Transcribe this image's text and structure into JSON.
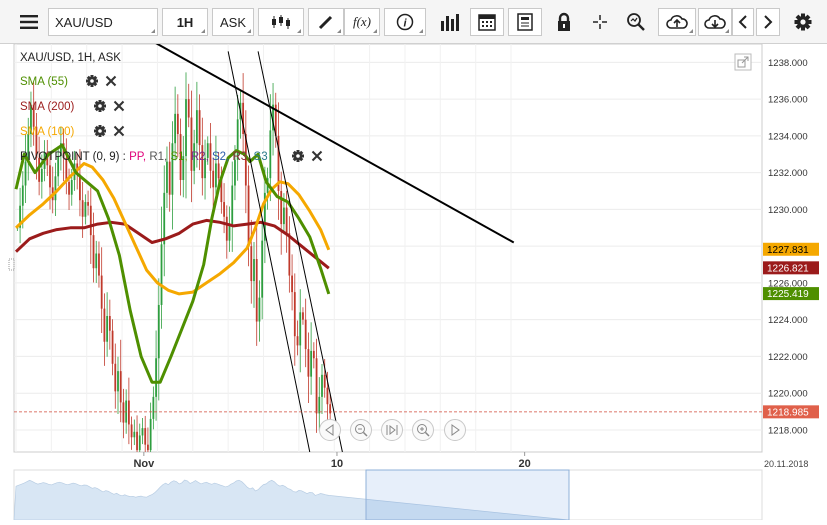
{
  "toolbar": {
    "symbol": "XAU/USD",
    "timeframe": "1H",
    "price_type": "ASK",
    "icons": [
      "menu-icon",
      "candles-icon",
      "pencil-icon",
      "function-icon",
      "info-icon",
      "volume-bars-icon",
      "calendar-icon",
      "news-icon",
      "lock-icon",
      "crosshair-icon",
      "zoom-icon",
      "upload-icon",
      "download-icon",
      "chevron-left-icon",
      "chevron-right-icon",
      "gear-icon"
    ],
    "function_label": "f(x)",
    "info_label": "i"
  },
  "chart_data": {
    "type": "candlestick",
    "title": "XAU/USD, 1H, ASK",
    "y_range": [
      1216.8,
      1239.0
    ],
    "y_ticks": [
      1218.0,
      1220.0,
      1222.0,
      1224.0,
      1226.0,
      1228.0,
      1230.0,
      1232.0,
      1234.0,
      1236.0,
      1238.0
    ],
    "x_ticks": [
      {
        "label": "Nov",
        "bar": 47
      },
      {
        "label": "10",
        "bar": 118
      },
      {
        "label": "20",
        "bar": 187
      }
    ],
    "x_end_label": "20.11.2018",
    "bar_count": 191,
    "indicators": [
      {
        "name": "SMA (55)",
        "color": "#4e8f00"
      },
      {
        "name": "SMA (200)",
        "color": "#9b1b1b"
      },
      {
        "name": "SMA (100)",
        "color": "#f5a800"
      }
    ],
    "pivot": {
      "label": "PIVOTPOINT (0, 9)",
      "colon": ":",
      "levels": [
        {
          "name": "PP",
          "color": "#e0007a"
        },
        {
          "name": "R1",
          "color": "#555555"
        },
        {
          "name": "S1",
          "color": "#4e8f00"
        },
        {
          "name": "R2",
          "color": "#7a2a8a"
        },
        {
          "name": "S2",
          "color": "#2a5caa"
        },
        {
          "name": "R3",
          "color": "#8a2a3a"
        },
        {
          "name": "S3",
          "color": "#2a7a8a"
        }
      ]
    },
    "price_labels": [
      {
        "value": 1227.831,
        "text": "1227.831",
        "color": "#f5a800",
        "text_color": "#000000"
      },
      {
        "value": 1226.821,
        "text": "1226.821",
        "color": "#9b1b1b",
        "text_color": "#ffffff"
      },
      {
        "value": 1225.419,
        "text": "1225.419",
        "color": "#4e8f00",
        "text_color": "#ffffff"
      },
      {
        "value": 1218.985,
        "text": "1218.985",
        "color": "#e0604a",
        "text_color": "#ffffff"
      }
    ],
    "current_price": 1218.985,
    "trend_lines": [
      {
        "color": "#000000",
        "width": 2,
        "points": [
          [
            -5,
            1243.7
          ],
          [
            183,
            1228.2
          ]
        ]
      },
      {
        "color": "#000000",
        "width": 1,
        "points": [
          [
            78,
            1238.6
          ],
          [
            108,
            1216.8
          ]
        ]
      },
      {
        "color": "#000000",
        "width": 1,
        "points": [
          [
            89,
            1238.6
          ],
          [
            120,
            1216.8
          ]
        ]
      }
    ],
    "sma55_points": [
      [
        0,
        1231.1
      ],
      [
        3,
        1233.0
      ],
      [
        7,
        1232.0
      ],
      [
        12,
        1233.0
      ],
      [
        17,
        1233.5
      ],
      [
        22,
        1232.0
      ],
      [
        26,
        1231.5
      ],
      [
        30,
        1231.0
      ],
      [
        34,
        1229.5
      ],
      [
        38,
        1227.5
      ],
      [
        42,
        1224.5
      ],
      [
        46,
        1222.0
      ],
      [
        50,
        1220.6
      ],
      [
        53,
        1220.6
      ],
      [
        57,
        1222.0
      ],
      [
        61,
        1223.5
      ],
      [
        65,
        1225.0
      ],
      [
        69,
        1227.0
      ],
      [
        72,
        1229.5
      ],
      [
        75,
        1231.5
      ],
      [
        78,
        1232.8
      ],
      [
        81,
        1233.2
      ],
      [
        84,
        1233.0
      ],
      [
        86,
        1232.6
      ],
      [
        89,
        1233.0
      ],
      [
        92,
        1231.5
      ],
      [
        96,
        1230.7
      ],
      [
        100,
        1230.4
      ],
      [
        104,
        1229.5
      ],
      [
        108,
        1228.5
      ],
      [
        112,
        1226.8
      ],
      [
        115,
        1225.4
      ]
    ],
    "sma200_points": [
      [
        0,
        1227.7
      ],
      [
        5,
        1228.4
      ],
      [
        10,
        1228.7
      ],
      [
        15,
        1228.9
      ],
      [
        20,
        1229.0
      ],
      [
        25,
        1229.0
      ],
      [
        30,
        1229.2
      ],
      [
        35,
        1229.3
      ],
      [
        40,
        1229.2
      ],
      [
        45,
        1228.7
      ],
      [
        50,
        1228.2
      ],
      [
        55,
        1228.4
      ],
      [
        60,
        1228.7
      ],
      [
        65,
        1229.2
      ],
      [
        70,
        1229.4
      ],
      [
        75,
        1229.3
      ],
      [
        80,
        1229.1
      ],
      [
        85,
        1229.2
      ],
      [
        90,
        1229.3
      ],
      [
        95,
        1229.1
      ],
      [
        100,
        1228.6
      ],
      [
        105,
        1228.0
      ],
      [
        110,
        1227.4
      ],
      [
        115,
        1226.8
      ]
    ],
    "sma100_points": [
      [
        0,
        1229.0
      ],
      [
        5,
        1229.7
      ],
      [
        10,
        1230.3
      ],
      [
        15,
        1231.0
      ],
      [
        20,
        1231.8
      ],
      [
        25,
        1232.5
      ],
      [
        28,
        1232.3
      ],
      [
        32,
        1231.6
      ],
      [
        36,
        1230.6
      ],
      [
        40,
        1229.3
      ],
      [
        44,
        1228.0
      ],
      [
        48,
        1226.7
      ],
      [
        52,
        1226.0
      ],
      [
        56,
        1225.6
      ],
      [
        60,
        1225.4
      ],
      [
        65,
        1225.5
      ],
      [
        70,
        1226.0
      ],
      [
        75,
        1226.5
      ],
      [
        80,
        1227.1
      ],
      [
        85,
        1227.9
      ],
      [
        88,
        1229.0
      ],
      [
        91,
        1230.3
      ],
      [
        94,
        1231.1
      ],
      [
        97,
        1231.5
      ],
      [
        100,
        1231.4
      ],
      [
        104,
        1230.8
      ],
      [
        108,
        1229.9
      ],
      [
        112,
        1228.9
      ],
      [
        115,
        1227.8
      ]
    ],
    "series": [
      {
        "name": "price",
        "values": [
          1229,
          1230.2,
          1231.3,
          1232.6,
          1234.1,
          1235.7,
          1234.5,
          1232.8,
          1231.5,
          1232.2,
          1233.1,
          1232.4,
          1231.2,
          1230.5,
          1231.8,
          1232.9,
          1233.6,
          1232.8,
          1231.5,
          1230.8,
          1231.6,
          1232.5,
          1231.9,
          1230.5,
          1229.6,
          1230.4,
          1230.2,
          1228.6,
          1226.8,
          1227.6,
          1226.4,
          1224.6,
          1222.8,
          1224.2,
          1223.4,
          1221.6,
          1220.1,
          1221.2,
          1219.5,
          1218.4,
          1219.6,
          1218.3,
          1217.6,
          1217.9,
          1216.9,
          1217.7,
          1218.1,
          1217.2,
          1216.9,
          1218.6,
          1219.8,
          1221.9,
          1224.8,
          1228.1,
          1230.9,
          1232.6,
          1230.8,
          1233.6,
          1235.2,
          1234.1,
          1231.6,
          1232.9,
          1236.0,
          1235.0,
          1232.1,
          1233.6,
          1235.4,
          1233.5,
          1231.7,
          1232.8,
          1233.6,
          1232.1,
          1231.2,
          1232.5,
          1231.7,
          1230.4,
          1229.6,
          1228.3,
          1229.2,
          1231.3,
          1232.7,
          1234.9,
          1235.8,
          1234.1,
          1231.3,
          1228.0,
          1226.1,
          1227.3,
          1223.9,
          1225.2,
          1228.3,
          1230.9,
          1231.7,
          1234.3,
          1235.7,
          1234.0,
          1231.0,
          1229.2,
          1230.1,
          1228.7,
          1226.4,
          1225.5,
          1223.1,
          1222.6,
          1224.4,
          1224.0,
          1222.4,
          1220.9,
          1222.3,
          1221.9,
          1218.9,
          1219.8,
          1221.0,
          1220.3,
          1219.4,
          1218.9
        ]
      }
    ]
  },
  "legend_icons": [
    "gear-icon",
    "close-icon"
  ],
  "nav_controls": [
    "scroll-left-icon",
    "zoom-out-icon",
    "reset-icon",
    "zoom-in-icon",
    "scroll-right-icon"
  ],
  "expand_icon": "expand-icon"
}
